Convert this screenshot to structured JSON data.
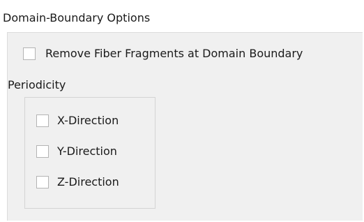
{
  "domain_boundary": {
    "title": "Domain-Boundary Options",
    "remove_fragments": {
      "label": "Remove Fiber Fragments at Domain Boundary",
      "checked": false
    },
    "periodicity": {
      "label": "Periodicity",
      "options": [
        {
          "label": "X-Direction",
          "checked": false
        },
        {
          "label": "Y-Direction",
          "checked": false
        },
        {
          "label": "Z-Direction",
          "checked": false
        }
      ]
    }
  }
}
